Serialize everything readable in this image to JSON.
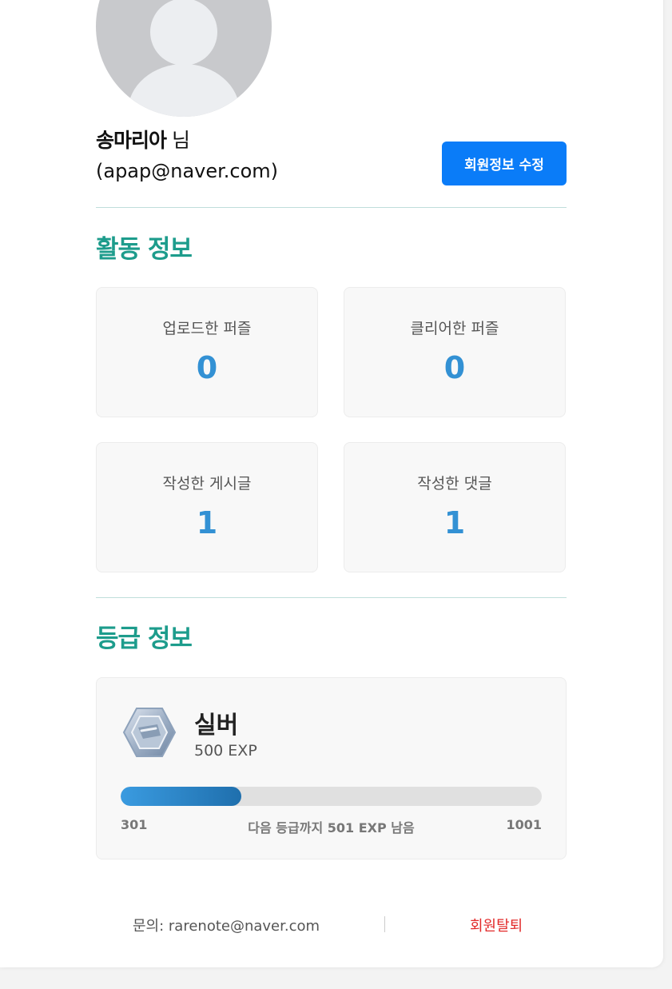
{
  "profile": {
    "name": "송마리아",
    "honorific": "님",
    "email": "(apap@naver.com)",
    "edit_button": "회원정보 수정"
  },
  "activity": {
    "title": "활동 정보",
    "stats": [
      {
        "label": "업로드한 퍼즐",
        "value": "0"
      },
      {
        "label": "클리어한 퍼즐",
        "value": "0"
      },
      {
        "label": "작성한 게시글",
        "value": "1"
      },
      {
        "label": "작성한 댓글",
        "value": "1"
      }
    ]
  },
  "grade": {
    "title": "등급 정보",
    "badge_icon": "silver-hexagon-badge-icon",
    "name": "실버",
    "exp": "500 EXP",
    "progress_min": "301",
    "progress_max": "1001",
    "progress_text": "다음 등급까지 501 EXP 남음",
    "progress_fraction": 0.2857
  },
  "footer": {
    "contact": "문의: rarenote@naver.com",
    "withdraw": "회원탈퇴"
  },
  "colors": {
    "accent": "#1d9c8c",
    "primary_button": "#0a7cf8",
    "stat_value": "#3391d4",
    "danger": "#e22a2a"
  }
}
